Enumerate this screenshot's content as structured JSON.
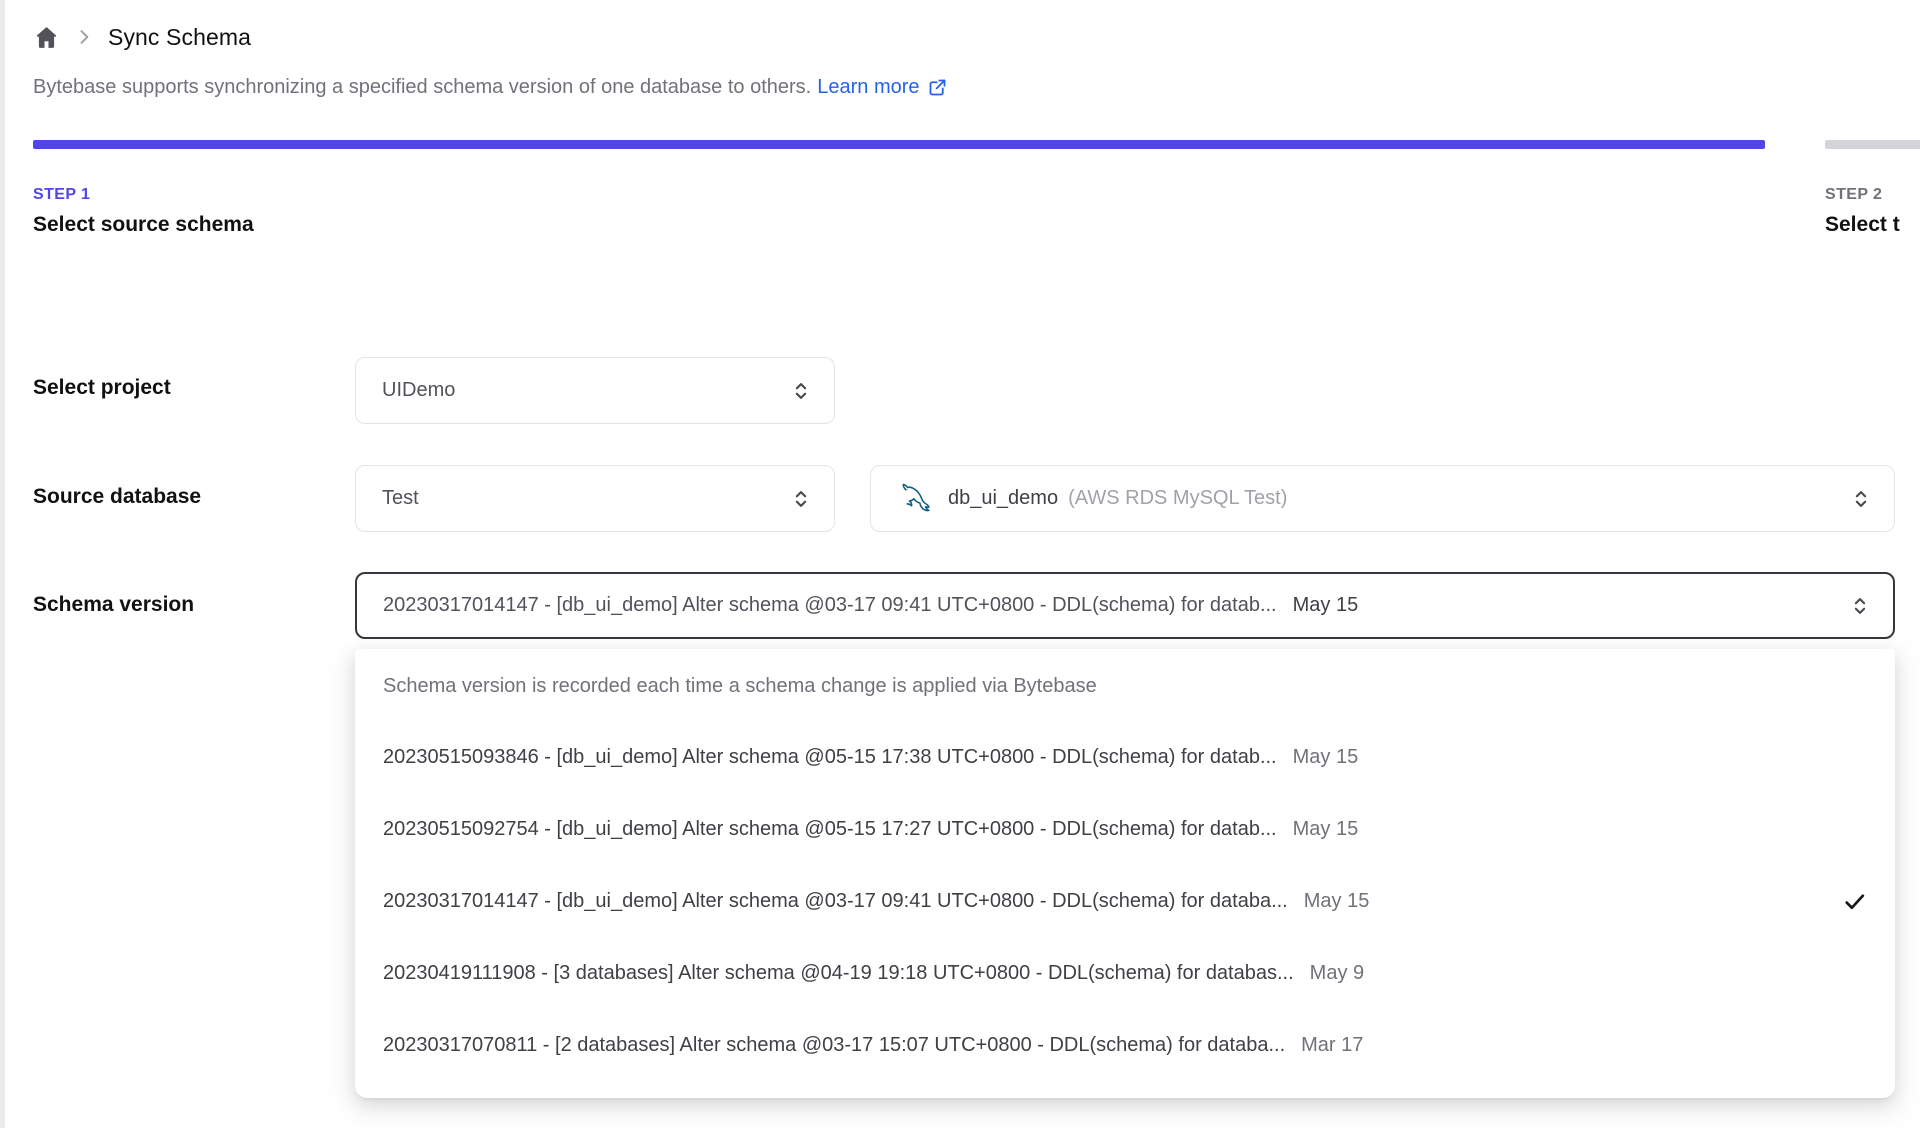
{
  "colors": {
    "accent_indigo": "#4f46e5",
    "link_blue": "#2563eb",
    "bar_remaining_gray": "#d4d4d8",
    "focus_border": "#36363c"
  },
  "breadcrumb": {
    "title": "Sync Schema"
  },
  "intro": {
    "text": "Bytebase supports synchronizing a specified schema version of one database to others.",
    "link_label": "Learn more"
  },
  "steps": [
    {
      "step": "STEP 1",
      "title": "Select source schema"
    },
    {
      "step": "STEP 2",
      "title": "Select t"
    }
  ],
  "form": {
    "project": {
      "label": "Select project",
      "value": "UIDemo"
    },
    "source_database": {
      "label": "Source database",
      "environment_value": "Test",
      "database_value": "db_ui_demo",
      "database_detail": "(AWS RDS MySQL Test)",
      "database_icon": "mysql-dolphin"
    },
    "schema_version": {
      "label": "Schema version",
      "value": "20230317014147 - [db_ui_demo] Alter schema @03-17 09:41 UTC+0800 - DDL(schema) for datab...",
      "date": "May 15"
    }
  },
  "dropdown": {
    "header": "Schema version is recorded each time a schema change is applied via Bytebase",
    "options": [
      {
        "text": "20230515093846 - [db_ui_demo] Alter schema @05-15 17:38 UTC+0800 - DDL(schema) for datab...",
        "date": "May 15",
        "selected": false
      },
      {
        "text": "20230515092754 - [db_ui_demo] Alter schema @05-15 17:27 UTC+0800 - DDL(schema) for datab...",
        "date": "May 15",
        "selected": false
      },
      {
        "text": "20230317014147 - [db_ui_demo] Alter schema @03-17 09:41 UTC+0800 - DDL(schema) for databa...",
        "date": "May 15",
        "selected": true
      },
      {
        "text": "20230419111908 - [3 databases] Alter schema @04-19 19:18 UTC+0800 - DDL(schema) for databas...",
        "date": "May 9",
        "selected": false
      },
      {
        "text": "20230317070811 - [2 databases] Alter schema @03-17 15:07 UTC+0800 - DDL(schema) for databa...",
        "date": "Mar 17",
        "selected": false
      }
    ]
  }
}
